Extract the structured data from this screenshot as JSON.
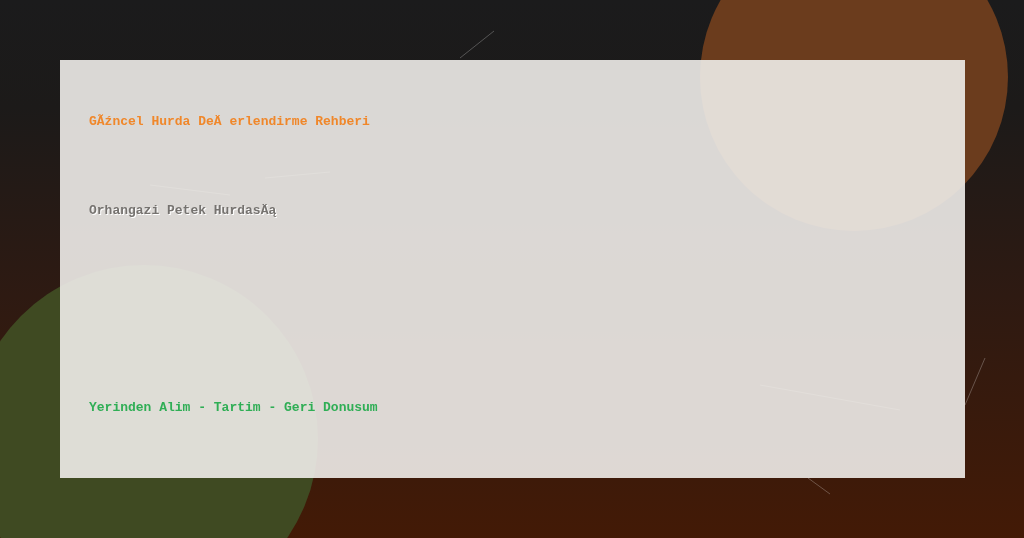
{
  "banner": {
    "title": "GÃźncel Hurda DeÄ erlendirme Rehberi",
    "subtitle": "Orhangazi Petek HurdasÄą",
    "tagline": "Yerinden Alim - Tartim - Geri Donusum"
  }
}
